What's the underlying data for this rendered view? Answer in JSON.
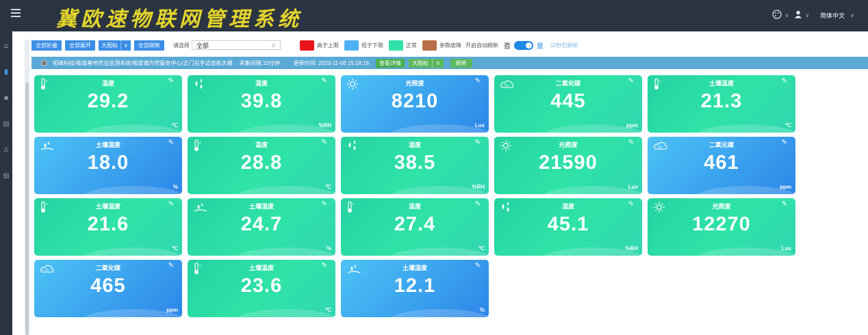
{
  "header": {
    "title": "冀欧速物联网管理系统",
    "language": "简体中文"
  },
  "icons": {
    "menu": "hamburger-icon",
    "theme": "palette-icon",
    "user": "user-icon"
  },
  "toolbar": {
    "collapse_all": "全部折叠",
    "expand_all": "全部展开",
    "big_icon": "大图标",
    "refresh_all": "全部刷新",
    "select_label": "请选择",
    "select_value": "全部",
    "legend": [
      {
        "label": "高于上限",
        "color": "#e8161b"
      },
      {
        "label": "低于下限",
        "color": "#4db1f3"
      },
      {
        "label": "正常",
        "color": "#2fe0a9"
      },
      {
        "label": "参数故障",
        "color": "#b86f47"
      }
    ],
    "auto_refresh_label": "开启自动刷新",
    "no_label": "否",
    "yes_label": "是",
    "countdown": "12秒后刷新"
  },
  "infobar": {
    "path": "拓峰科技/瓶窑基地农业监测系统/瓶窑镇为农服务中心/正门右手边连栋大棚",
    "interval": "采集间隔:10分钟",
    "update_time": "更新时间: 2020-11-06 15:18:16",
    "view_details": "查看详情",
    "big_icon": "大图标",
    "refresh": "刷新"
  },
  "cards": [
    {
      "name": "温度",
      "value": "29.2",
      "unit": "℃",
      "color": "green",
      "icon": "thermometer-icon"
    },
    {
      "name": "湿度",
      "value": "39.8",
      "unit": "%RH",
      "color": "green",
      "icon": "humidity-drops-icon"
    },
    {
      "name": "光照度",
      "value": "8210",
      "unit": "Lux",
      "color": "blue",
      "icon": "sun-icon"
    },
    {
      "name": "二氧化碳",
      "value": "445",
      "unit": "ppm",
      "color": "green",
      "icon": "co2-cloud-icon"
    },
    {
      "name": "土壤温度",
      "value": "21.3",
      "unit": "℃",
      "color": "green",
      "icon": "thermometer-icon"
    },
    {
      "name": "土壤湿度",
      "value": "18.0",
      "unit": "%",
      "color": "blue",
      "icon": "soil-moisture-icon"
    },
    {
      "name": "温度",
      "value": "28.8",
      "unit": "℃",
      "color": "green",
      "icon": "thermometer-icon"
    },
    {
      "name": "湿度",
      "value": "38.5",
      "unit": "%RH",
      "color": "green",
      "icon": "humidity-drops-icon"
    },
    {
      "name": "光照度",
      "value": "21590",
      "unit": "Lux",
      "color": "green",
      "icon": "sun-icon"
    },
    {
      "name": "二氧化碳",
      "value": "461",
      "unit": "ppm",
      "color": "blue",
      "icon": "co2-cloud-icon"
    },
    {
      "name": "土壤温度",
      "value": "21.6",
      "unit": "℃",
      "color": "green",
      "icon": "thermometer-icon"
    },
    {
      "name": "土壤湿度",
      "value": "24.7",
      "unit": "%",
      "color": "green",
      "icon": "soil-moisture-icon"
    },
    {
      "name": "温度",
      "value": "27.4",
      "unit": "℃",
      "color": "green",
      "icon": "thermometer-icon"
    },
    {
      "name": "湿度",
      "value": "45.1",
      "unit": "%RH",
      "color": "green",
      "icon": "humidity-drops-icon"
    },
    {
      "name": "光照度",
      "value": "12270",
      "unit": "Lux",
      "color": "green",
      "icon": "sun-icon"
    },
    {
      "name": "二氧化碳",
      "value": "465",
      "unit": "ppm",
      "color": "blue",
      "icon": "co2-cloud-icon"
    },
    {
      "name": "土壤温度",
      "value": "23.6",
      "unit": "℃",
      "color": "green",
      "icon": "thermometer-icon"
    },
    {
      "name": "土壤湿度",
      "value": "12.1",
      "unit": "%",
      "color": "blue",
      "icon": "soil-moisture-icon"
    }
  ]
}
